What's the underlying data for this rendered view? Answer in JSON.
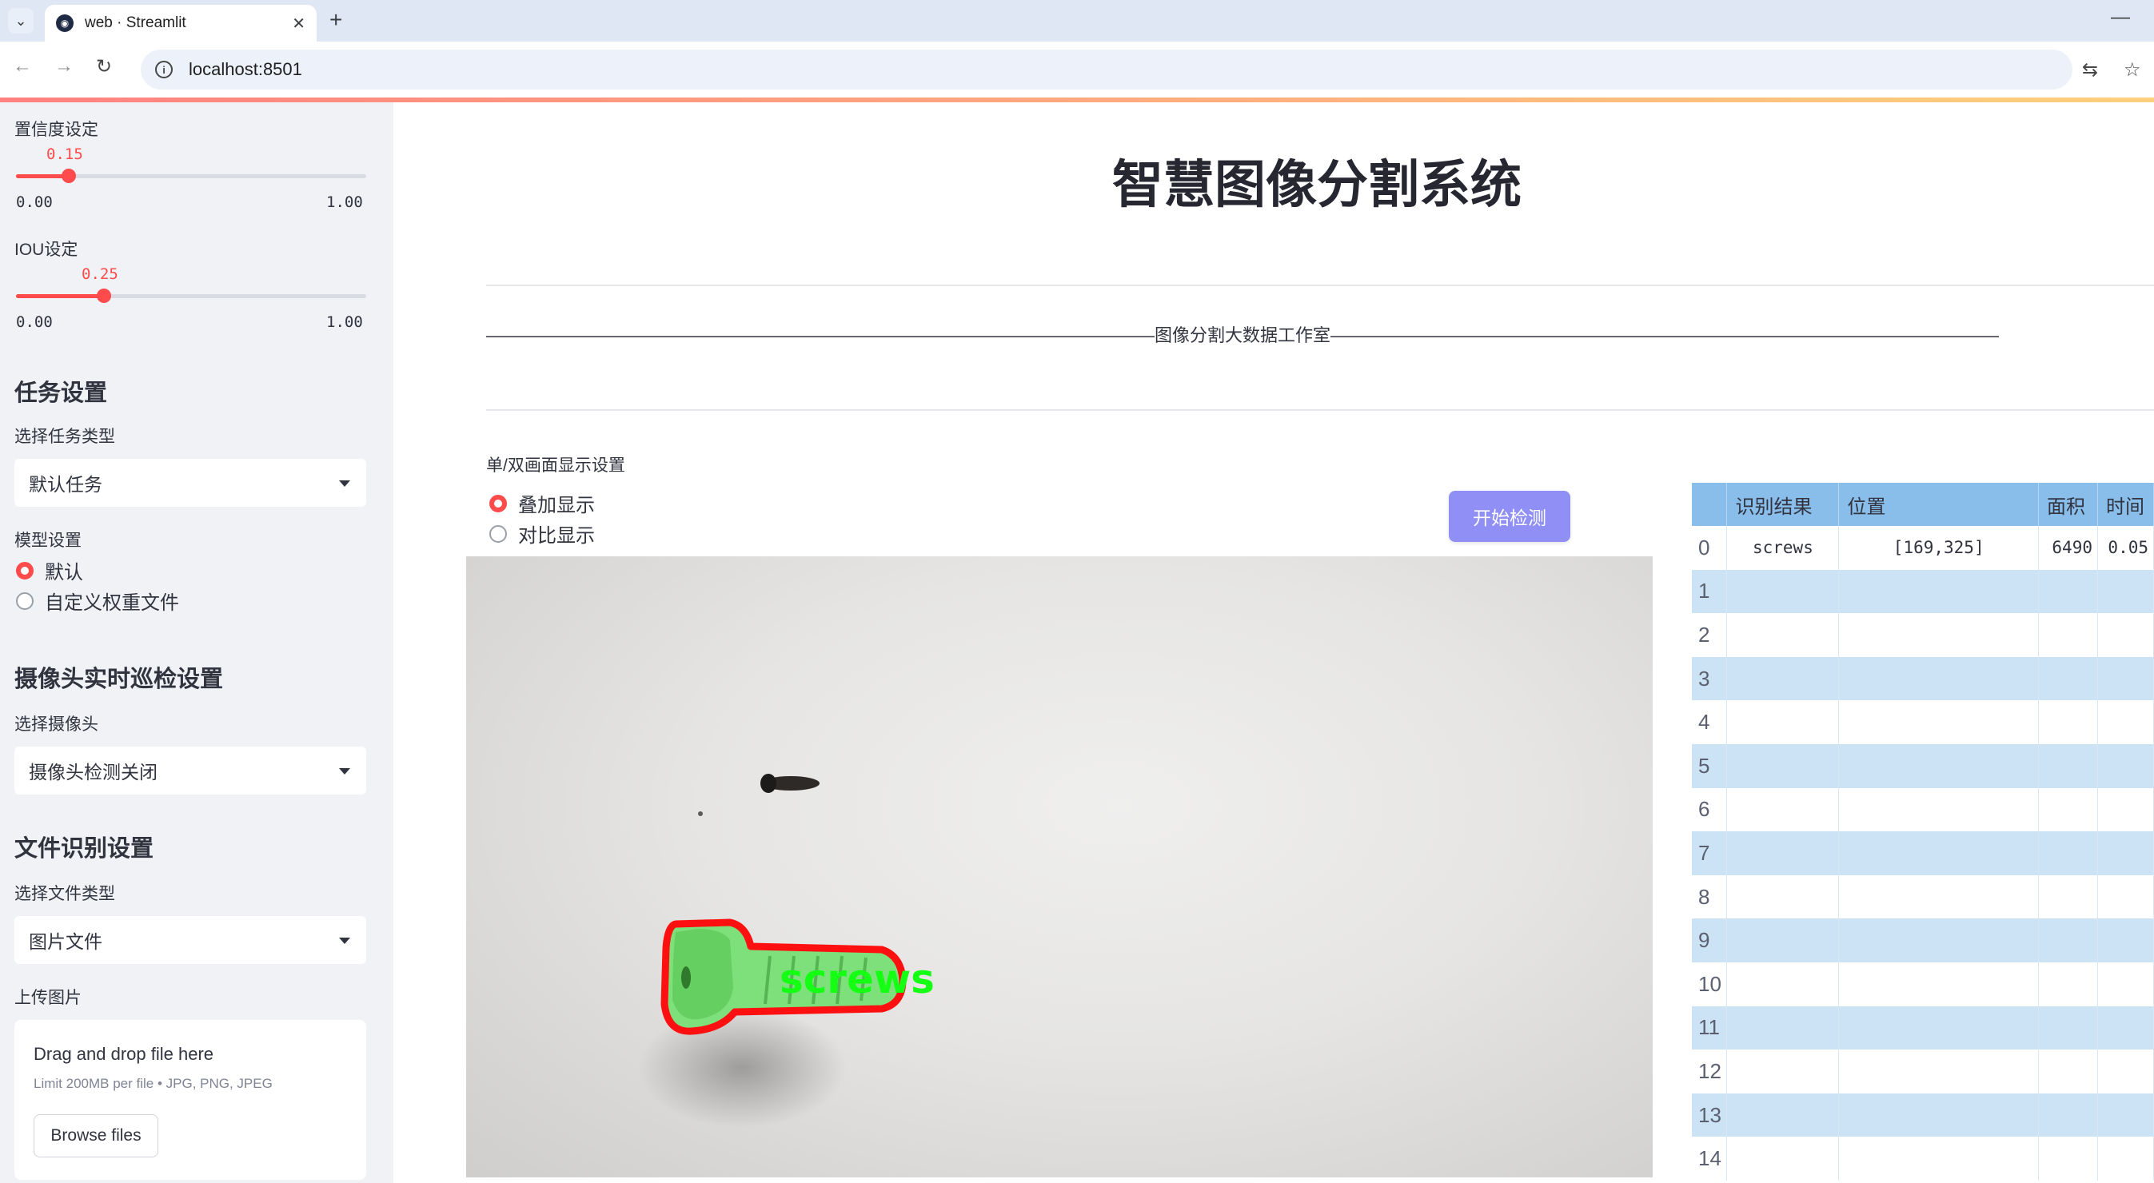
{
  "browser": {
    "tab_title": "web · Streamlit",
    "url": "localhost:8501"
  },
  "sidebar": {
    "confidence": {
      "label": "置信度设定",
      "value": "0.15",
      "min": "0.00",
      "max": "1.00",
      "fraction": 0.15
    },
    "iou": {
      "label": "IOU设定",
      "value": "0.25",
      "min": "0.00",
      "max": "1.00",
      "fraction": 0.25
    },
    "task_header": "任务设置",
    "task_type_label": "选择任务类型",
    "task_type_value": "默认任务",
    "model_label": "模型设置",
    "model_options": [
      "默认",
      "自定义权重文件"
    ],
    "camera_header": "摄像头实时巡检设置",
    "camera_label": "选择摄像头",
    "camera_value": "摄像头检测关闭",
    "file_header": "文件识别设置",
    "file_type_label": "选择文件类型",
    "file_type_value": "图片文件",
    "upload_label": "上传图片",
    "upload_title": "Drag and drop file here",
    "upload_limit": "Limit 200MB per file • JPG, PNG, JPEG",
    "browse_label": "Browse files"
  },
  "main": {
    "title": "智慧图像分割系统",
    "subtitle": "——————————————————————————————————————图像分割大数据工作室——————————————————————————————————————",
    "display_label": "单/双画面显示设置",
    "display_options": [
      "叠加显示",
      "对比显示"
    ],
    "detect_button": "开始检测",
    "image_detection_label": "screws"
  },
  "results_table": {
    "columns": [
      "识别结果",
      "位置",
      "面积",
      "时间"
    ],
    "rows": [
      {
        "index": "0",
        "result": "screws",
        "position": "[169,325]",
        "area": "6490",
        "time": "0.05"
      },
      {
        "index": "1",
        "result": "",
        "position": "",
        "area": "",
        "time": ""
      },
      {
        "index": "2",
        "result": "",
        "position": "",
        "area": "",
        "time": ""
      },
      {
        "index": "3",
        "result": "",
        "position": "",
        "area": "",
        "time": ""
      },
      {
        "index": "4",
        "result": "",
        "position": "",
        "area": "",
        "time": ""
      },
      {
        "index": "5",
        "result": "",
        "position": "",
        "area": "",
        "time": ""
      },
      {
        "index": "6",
        "result": "",
        "position": "",
        "area": "",
        "time": ""
      },
      {
        "index": "7",
        "result": "",
        "position": "",
        "area": "",
        "time": ""
      },
      {
        "index": "8",
        "result": "",
        "position": "",
        "area": "",
        "time": ""
      },
      {
        "index": "9",
        "result": "",
        "position": "",
        "area": "",
        "time": ""
      },
      {
        "index": "10",
        "result": "",
        "position": "",
        "area": "",
        "time": ""
      },
      {
        "index": "11",
        "result": "",
        "position": "",
        "area": "",
        "time": ""
      },
      {
        "index": "12",
        "result": "",
        "position": "",
        "area": "",
        "time": ""
      },
      {
        "index": "13",
        "result": "",
        "position": "",
        "area": "",
        "time": ""
      },
      {
        "index": "14",
        "result": "",
        "position": "",
        "area": "",
        "time": ""
      }
    ]
  },
  "colors": {
    "accent": "#ff4b4b",
    "button": "#8f8ff5",
    "table_header": "#89bdea",
    "table_stripe": "#cce3f6",
    "mask_fill": "#7ee07a",
    "mask_outline": "#ff0000",
    "label_text": "#00ff00"
  }
}
